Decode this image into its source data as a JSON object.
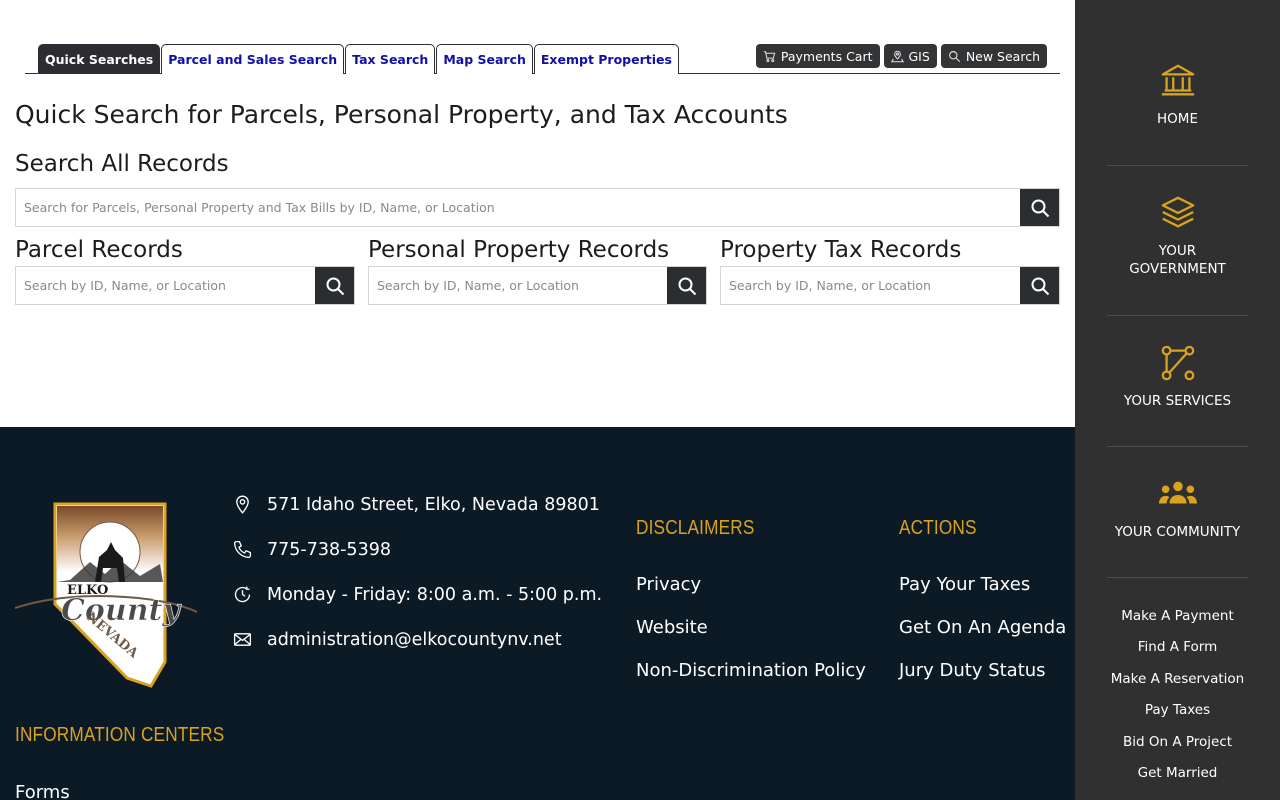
{
  "tabs": [
    {
      "label": "Quick Searches",
      "active": true
    },
    {
      "label": "Parcel and Sales Search",
      "active": false
    },
    {
      "label": "Tax Search",
      "active": false
    },
    {
      "label": "Map Search",
      "active": false
    },
    {
      "label": "Exempt Properties",
      "active": false
    }
  ],
  "tools": {
    "payments_cart": "Payments Cart",
    "gis": "GIS",
    "new_search": "New Search"
  },
  "main": {
    "title": "Quick Search for Parcels, Personal Property, and Tax Accounts",
    "all_records": {
      "heading": "Search All Records",
      "placeholder": "Search for Parcels, Personal Property and Tax Bills by ID, Name, or Location"
    },
    "parcel": {
      "heading": "Parcel Records",
      "placeholder": "Search by ID, Name, or Location"
    },
    "personal": {
      "heading": "Personal Property Records",
      "placeholder": "Search by ID, Name, or Location"
    },
    "tax": {
      "heading": "Property Tax Records",
      "placeholder": "Search by ID, Name, or Location"
    }
  },
  "footer": {
    "logo_text": {
      "top": "ELKO",
      "middle": "County",
      "bottom": "NEVADA"
    },
    "address": "571 Idaho Street, Elko, Nevada 89801",
    "phone": "775-738-5398",
    "hours": "Monday - Friday: 8:00 a.m. - 5:00 p.m.",
    "email": "administration@elkocountynv.net",
    "disclaimers": {
      "heading": "DISCLAIMERS",
      "links": [
        "Privacy",
        "Website",
        "Non-Discrimination Policy"
      ]
    },
    "actions": {
      "heading": "ACTIONS",
      "links": [
        "Pay Your Taxes",
        "Get On An Agenda",
        "Jury Duty Status"
      ]
    },
    "info_centers": {
      "heading": "INFORMATION CENTERS",
      "links": [
        "Forms"
      ]
    }
  },
  "sidebar": {
    "home": "HOME",
    "government_line1": "YOUR",
    "government_line2": "GOVERNMENT",
    "services": "YOUR SERVICES",
    "community": "YOUR COMMUNITY",
    "links": [
      "Make A Payment",
      "Find A Form",
      "Make A Reservation",
      "Pay Taxes",
      "Bid On A Project",
      "Get Married"
    ]
  },
  "colors": {
    "accent_gold": "#d9a21f",
    "footer_bg": "#0c1a26",
    "sidebar_bg": "#303030",
    "tab_link": "#1010a8"
  }
}
